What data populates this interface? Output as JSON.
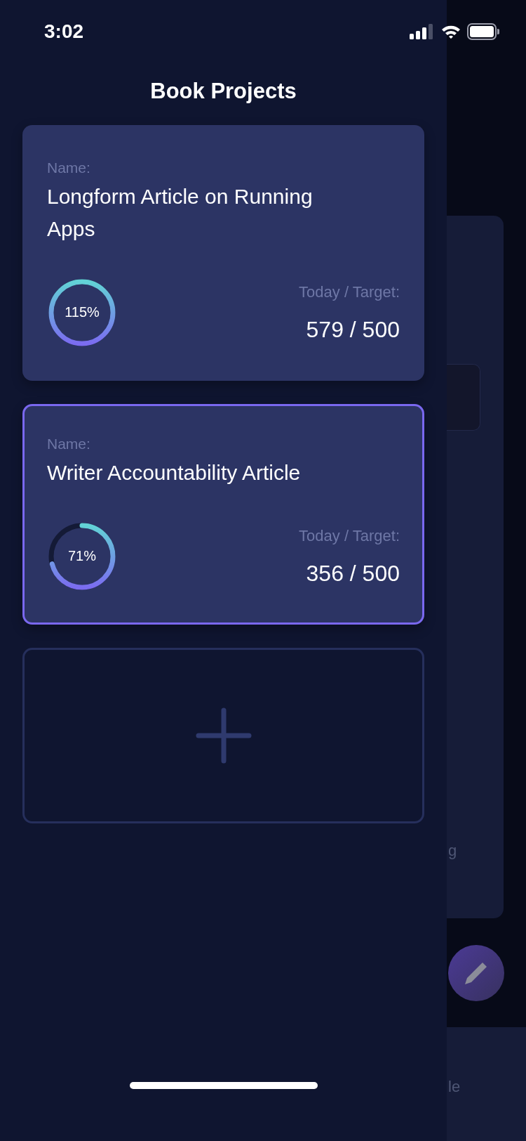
{
  "status_bar": {
    "time": "3:02"
  },
  "drawer": {
    "title": "Book Projects",
    "projects": [
      {
        "name_label": "Name:",
        "name": "Longform Article on Running Apps",
        "percent": "115%",
        "level": 1,
        "target_label": "Today / Target:",
        "count": "579 / 500",
        "selected": false
      },
      {
        "name_label": "Name:",
        "name": "Writer Accountability Article",
        "percent": "71%",
        "level": 0.71,
        "target_label": "Today / Target:",
        "count": "356 / 500",
        "selected": true
      }
    ]
  },
  "background": {
    "panel_text": "g",
    "bottom_bar_text": "le"
  }
}
